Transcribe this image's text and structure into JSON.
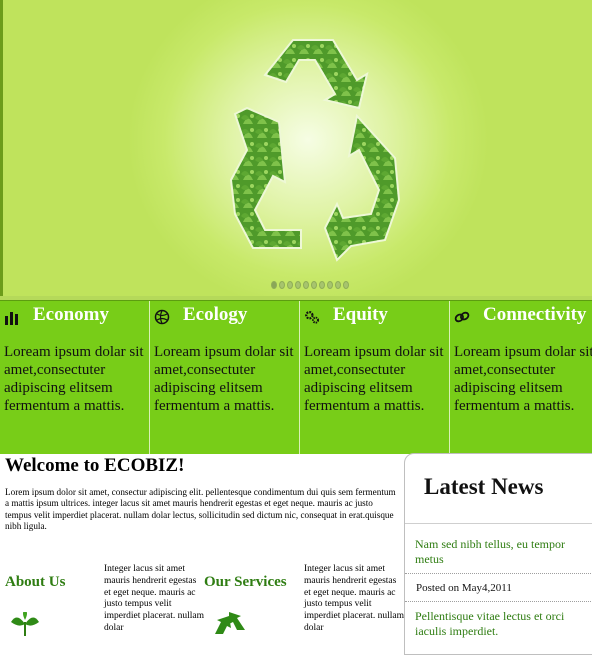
{
  "hero": {
    "slider_dots": 10,
    "active_dot": 0
  },
  "features": [
    {
      "title": "Economy",
      "icon": "bar-chart-icon",
      "text": "Loream ipsum dolar sit amet,consectuter adipiscing elitsem fermentum a mattis."
    },
    {
      "title": "Ecology",
      "icon": "globe-icon",
      "text": "Loream ipsum dolar sit amet,consectuter adipiscing elitsem fermentum a mattis."
    },
    {
      "title": "Equity",
      "icon": "gears-icon",
      "text": "Loream ipsum dolar sit amet,consectuter adipiscing elitsem fermentum a mattis."
    },
    {
      "title": "Connectivity",
      "icon": "link-icon",
      "text": "Loream ipsum dolar sit amet,consectuter adipiscing elitsem fermentum a mattis."
    }
  ],
  "welcome": {
    "title": "Welcome to ECOBIZ!",
    "text": "Lorem ipsum dolor sit amet, consectur adipiscing elit. pellentesque condimentum dui quis sem fermentum a mattis ipsum ultrices. integer lacus sit amet mauris hendrerit egestas et eget neque. mauris ac justo tempus velit imperdiet placerat. nullam dolar lectus, sollicitudin sed dictum nic, consequat in erat.quisque nibh ligula."
  },
  "about": {
    "title": "About Us",
    "text": "Integer lacus sit amet mauris hendrerit egestas et eget neque. mauris ac justo tempus velit imperdiet placerat. nullam dolar"
  },
  "services": {
    "title": "Our Services",
    "text": "Integer lacus sit amet mauris hendrerit egestas et eget neque. mauris ac justo tempus velit imperdiet placerat. nullam dolar"
  },
  "news": {
    "title": "Latest News",
    "item1": "Nam sed nibh tellus, eu tempor metus",
    "date": "Posted on May4,2011",
    "item2": "Pellentisque vitae lectus et orci iaculis imperdiet."
  },
  "colors": {
    "feature_bg": "#78cd18",
    "link_green": "#2f7d12"
  }
}
